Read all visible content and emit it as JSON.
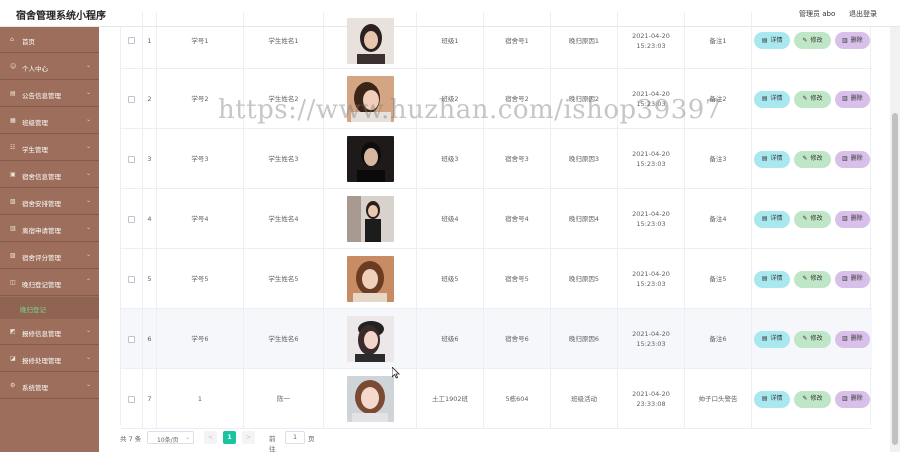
{
  "app": {
    "title": "宿舍管理系统小程序",
    "user": "管理员 abo",
    "logout": "退出登录"
  },
  "sidebar": {
    "items": [
      {
        "label": "首页",
        "icon": "home-icon"
      },
      {
        "label": "个人中心",
        "icon": "user-icon"
      },
      {
        "label": "公告信息管理",
        "icon": "notice-icon"
      },
      {
        "label": "班级管理",
        "icon": "class-icon"
      },
      {
        "label": "学生管理",
        "icon": "student-icon"
      },
      {
        "label": "宿舍信息管理",
        "icon": "dorm-icon"
      },
      {
        "label": "宿舍安排管理",
        "icon": "arrange-icon"
      },
      {
        "label": "离宿申请管理",
        "icon": "leave-icon"
      },
      {
        "label": "宿舍评分管理",
        "icon": "score-icon"
      },
      {
        "label": "晚归登记管理",
        "icon": "late-icon"
      },
      {
        "label": "报修信息管理",
        "icon": "repair-icon"
      },
      {
        "label": "报修处理管理",
        "icon": "repair-process-icon"
      },
      {
        "label": "系统管理",
        "icon": "system-icon"
      }
    ],
    "active_sub": "晚归登记"
  },
  "table": {
    "rows": [
      {
        "index": "1",
        "student_no": "学号1",
        "name": "学生姓名1",
        "class": "班级1",
        "dorm": "宿舍号1",
        "reason": "晚归原因1",
        "time": "2021-04-20 15:23:03",
        "remark": "备注1"
      },
      {
        "index": "2",
        "student_no": "学号2",
        "name": "学生姓名2",
        "class": "班级2",
        "dorm": "宿舍号2",
        "reason": "晚归原因2",
        "time": "2021-04-20 15:23:03",
        "remark": "备注2"
      },
      {
        "index": "3",
        "student_no": "学号3",
        "name": "学生姓名3",
        "class": "班级3",
        "dorm": "宿舍号3",
        "reason": "晚归原因3",
        "time": "2021-04-20 15:23:03",
        "remark": "备注3"
      },
      {
        "index": "4",
        "student_no": "学号4",
        "name": "学生姓名4",
        "class": "班级4",
        "dorm": "宿舍号4",
        "reason": "晚归原因4",
        "time": "2021-04-20 15:23:03",
        "remark": "备注4"
      },
      {
        "index": "5",
        "student_no": "学号5",
        "name": "学生姓名5",
        "class": "班级5",
        "dorm": "宿舍号5",
        "reason": "晚归原因5",
        "time": "2021-04-20 15:23:03",
        "remark": "备注5"
      },
      {
        "index": "6",
        "student_no": "学号6",
        "name": "学生姓名6",
        "class": "班级6",
        "dorm": "宿舍号6",
        "reason": "晚归原因6",
        "time": "2021-04-20 15:23:03",
        "remark": "备注6"
      },
      {
        "index": "7",
        "student_no": "1",
        "name": "陈一",
        "class": "土工1902班",
        "dorm": "5栋604",
        "reason": "班级活动",
        "time": "2021-04-20 23:33:08",
        "remark": "帅子口头警告"
      }
    ],
    "actions": {
      "detail": "详情",
      "edit": "修改",
      "delete": "删除"
    }
  },
  "pagination": {
    "total": "共 7 条",
    "page_size": "10条/页",
    "prev": "<",
    "next": ">",
    "current": "1",
    "goto": "前往",
    "goto_value": "1",
    "page_unit": "页"
  },
  "watermark": "https://www.huzhan.com/ishop39397",
  "colors": {
    "sidebar": "#9c6e5b",
    "detail_button": "#a9e8ee",
    "edit_button": "#bfe6c6",
    "delete_button": "#d9c0ea",
    "active_page": "#19c4a0"
  }
}
